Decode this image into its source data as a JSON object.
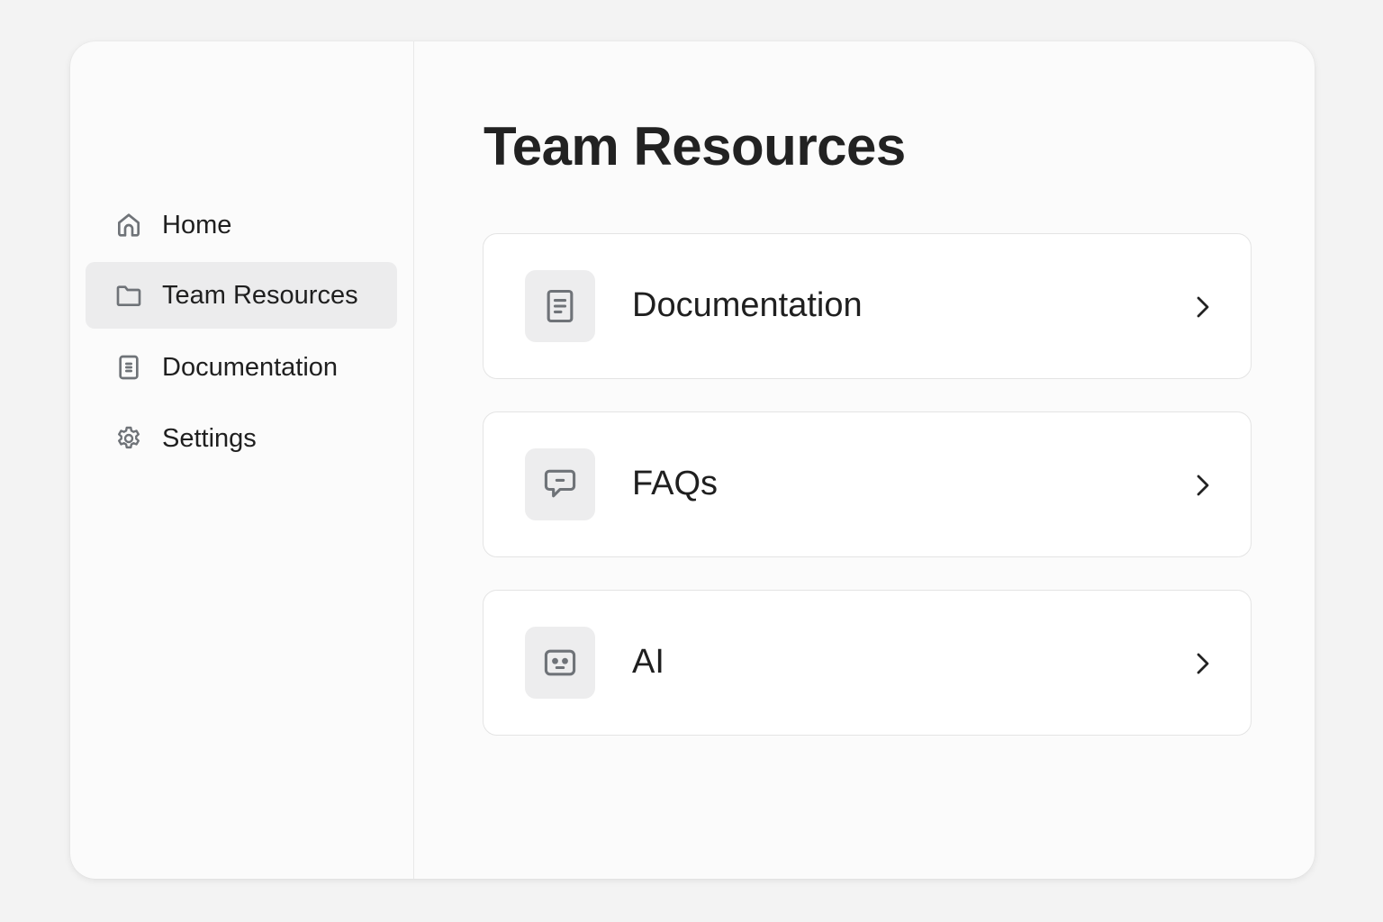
{
  "sidebar": {
    "items": [
      {
        "label": "Home",
        "icon": "home-icon"
      },
      {
        "label": "Team Resources",
        "icon": "folder-icon",
        "active": true
      },
      {
        "label": "Documentation",
        "icon": "document-icon"
      },
      {
        "label": "Settings",
        "icon": "gear-icon"
      }
    ]
  },
  "main": {
    "title": "Team Resources",
    "cards": [
      {
        "label": "Documentation",
        "icon": "document-icon"
      },
      {
        "label": "FAQs",
        "icon": "chat-bubble-icon"
      },
      {
        "label": "AI",
        "icon": "robot-icon"
      }
    ]
  },
  "colors": {
    "active_bg": "#ececed",
    "icon": "#6f7378"
  }
}
